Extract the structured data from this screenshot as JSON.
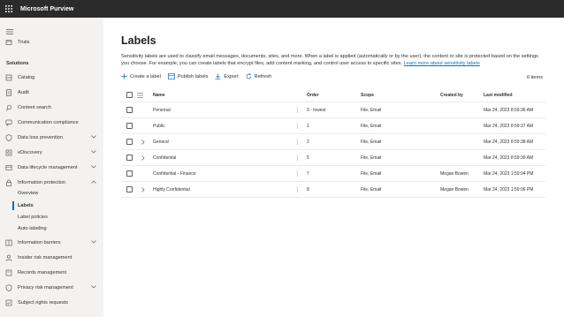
{
  "app": {
    "title": "Microsoft Purview"
  },
  "sidebar": {
    "trials": "Trials",
    "section": "Solutions",
    "items": [
      {
        "label": "Catalog"
      },
      {
        "label": "Audit"
      },
      {
        "label": "Content search"
      },
      {
        "label": "Communication compliance"
      },
      {
        "label": "Data loss prevention"
      },
      {
        "label": "eDiscovery"
      },
      {
        "label": "Data lifecycle management"
      },
      {
        "label": "Information protection"
      }
    ],
    "sub_items": [
      {
        "label": "Overview"
      },
      {
        "label": "Labels"
      },
      {
        "label": "Label policies"
      },
      {
        "label": "Auto-labeling"
      }
    ],
    "items_after": [
      {
        "label": "Information barriers"
      },
      {
        "label": "Insider risk management"
      },
      {
        "label": "Records management"
      },
      {
        "label": "Privacy risk management"
      },
      {
        "label": "Subject rights requests"
      }
    ]
  },
  "page": {
    "title": "Labels",
    "description": "Sensitivity labels are used to classify email messages, documents, sites, and more. When a label is applied (automatically or by the user), the content or site is protected based on the settings you choose. For example, you can create labels that encrypt files, add content marking, and control user access to specific sites.",
    "learn_more": "Learn more about sensitivity labels",
    "count": "6 items"
  },
  "toolbar": {
    "create": "Create a label",
    "publish": "Publish labels",
    "export": "Export",
    "refresh": "Refresh"
  },
  "table": {
    "headers": {
      "name": "Name",
      "order": "Order",
      "scope": "Scope",
      "created_by": "Created by",
      "last_modified": "Last modified"
    },
    "rows": [
      {
        "name": "Personal",
        "order": "0 - lowest",
        "scope": "File, Email",
        "created_by": "",
        "last_modified": "Mar 24, 2023 8:59:36 AM"
      },
      {
        "name": "Public",
        "order": "1",
        "scope": "File, Email",
        "created_by": "",
        "last_modified": "Mar 24, 2023 8:59:37 AM"
      },
      {
        "name": "General",
        "order": "2",
        "scope": "File, Email",
        "created_by": "",
        "last_modified": "Mar 24, 2023 8:59:38 AM"
      },
      {
        "name": "Confidential",
        "order": "5",
        "scope": "File, Email",
        "created_by": "",
        "last_modified": "Mar 24, 2023 8:59:39 AM"
      },
      {
        "name": "Confidential - Finance",
        "order": "7",
        "scope": "File, Email",
        "created_by": "Megan Bowen",
        "last_modified": "Mar 24, 2023 1:59:04 PM"
      },
      {
        "name": "Highly Confidential",
        "order": "8",
        "scope": "File, Email",
        "created_by": "Megan Bowen",
        "last_modified": "Mar 24, 2023 1:59:06 PM"
      }
    ]
  }
}
